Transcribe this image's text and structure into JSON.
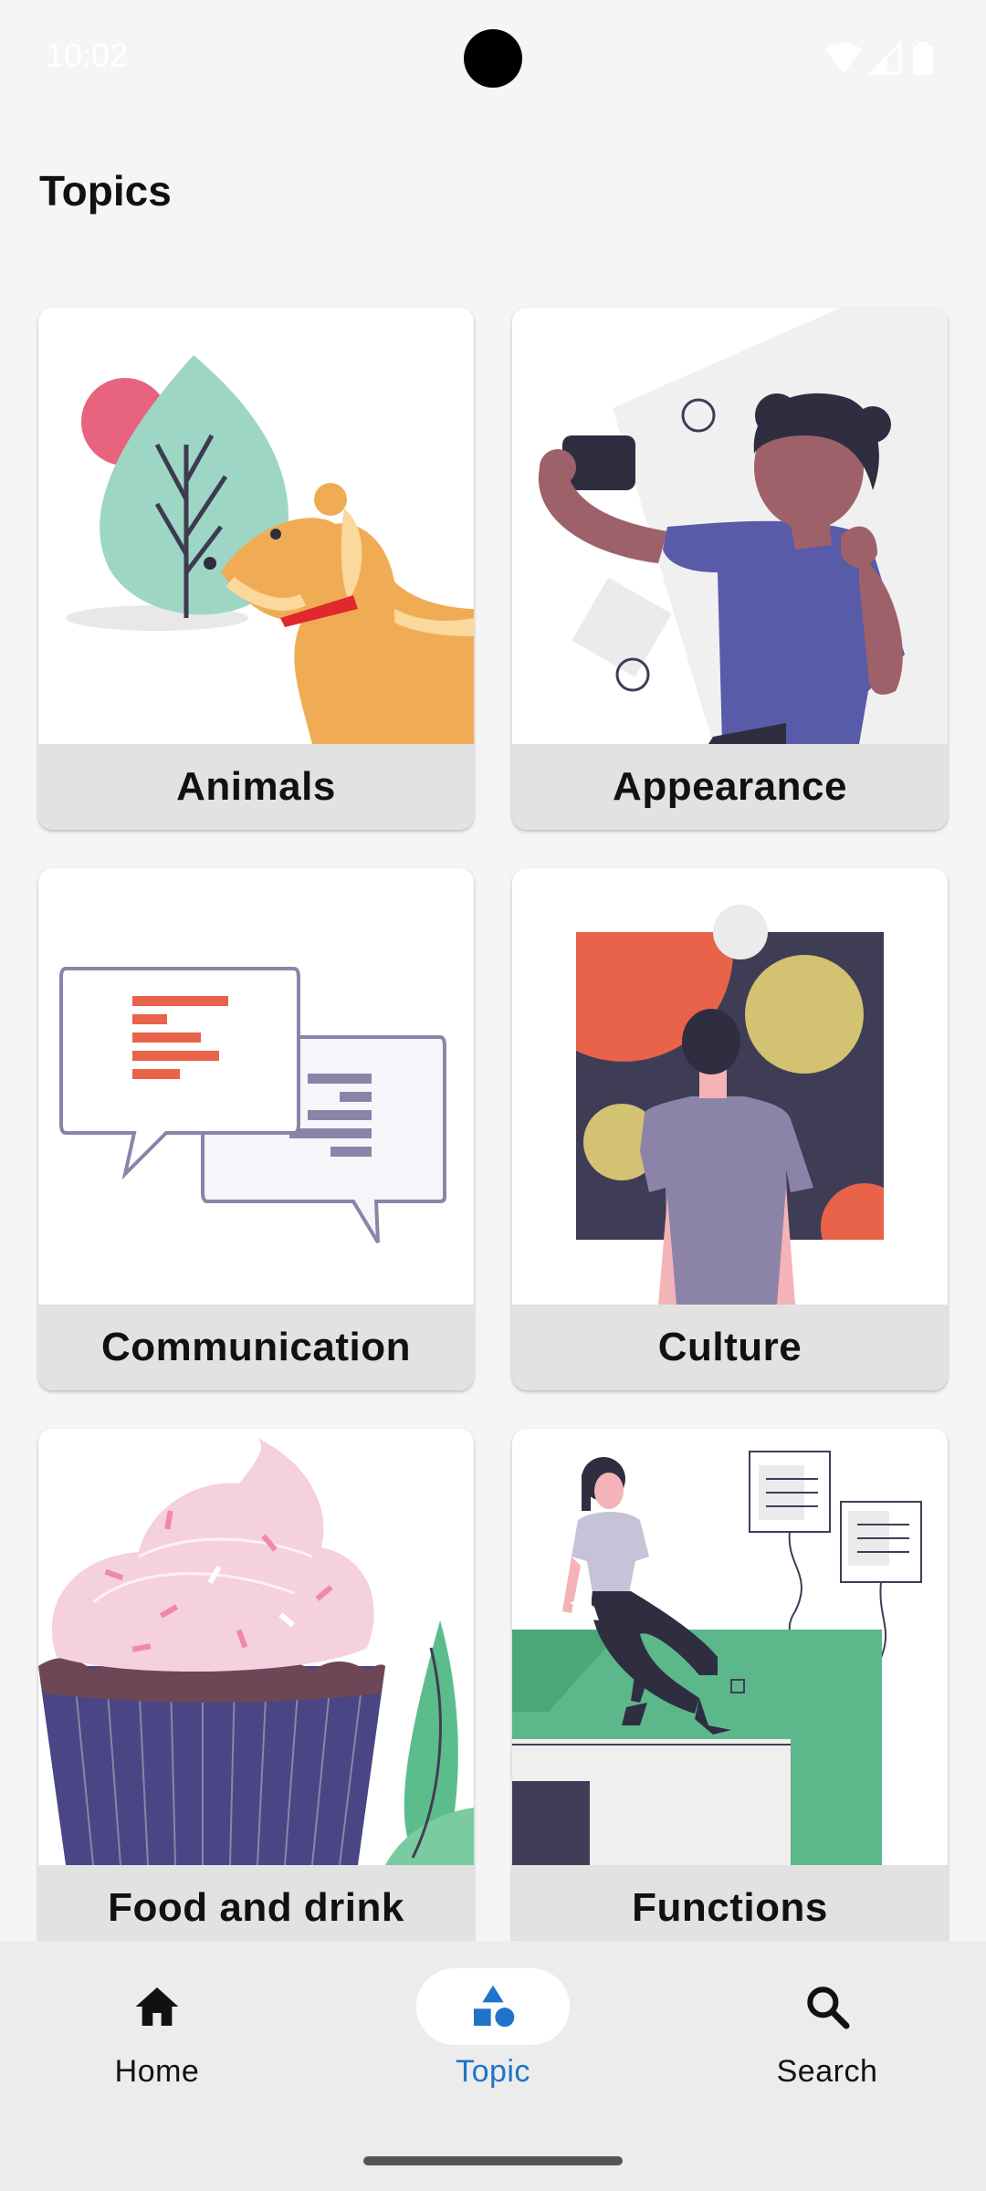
{
  "status_bar": {
    "time": "10:02",
    "icons": [
      "wifi-icon",
      "signal-icon",
      "battery-icon"
    ]
  },
  "page": {
    "title": "Topics"
  },
  "topics": [
    {
      "label": "Animals",
      "illustration": "dog-and-leaf"
    },
    {
      "label": "Appearance",
      "illustration": "selfie-person"
    },
    {
      "label": "Communication",
      "illustration": "chat-bubbles"
    },
    {
      "label": "Culture",
      "illustration": "person-viewing-art"
    },
    {
      "label": "Food and drink",
      "illustration": "cupcake"
    },
    {
      "label": "Functions",
      "illustration": "person-sitting-on-desk"
    }
  ],
  "bottom_nav": {
    "items": [
      {
        "label": "Home",
        "icon": "home-icon",
        "active": false
      },
      {
        "label": "Topic",
        "icon": "shapes-icon",
        "active": true
      },
      {
        "label": "Search",
        "icon": "search-icon",
        "active": false
      }
    ],
    "active_color": "#1f74c9"
  }
}
